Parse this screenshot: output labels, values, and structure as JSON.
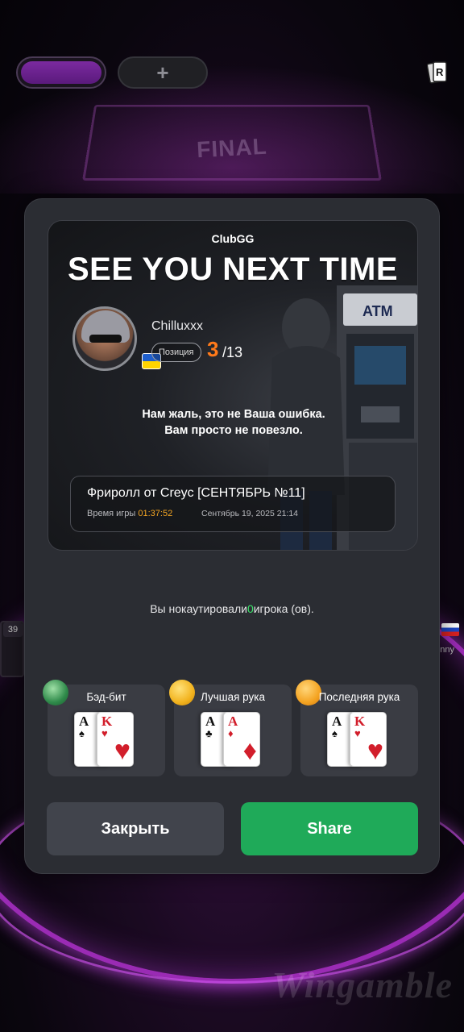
{
  "background": {
    "final_text": "FINAL",
    "left_seat_badge": "39",
    "right_seat_name": "nny",
    "watermark": "Wingamble"
  },
  "topbar": {
    "add_tab_label": "+",
    "corner_icon": "card-icon"
  },
  "card": {
    "brand": "ClubGG",
    "headline": "SEE YOU NEXT TIME",
    "player_name": "Chilluxxx",
    "position_label": "Позиция",
    "position_value": "3",
    "position_total": "/13",
    "flag": "ukraine-flag",
    "sorry_line1": "Нам жаль, это не Ваша ошибка.",
    "sorry_line2": "Вам просто не повезло.",
    "tournament_name": "Фриролл от Creyc [СЕНТЯБРЬ №11]",
    "play_time_label": "Время игры",
    "play_time": "01:37:52",
    "date": "Сентябрь 19, 2025 21:14"
  },
  "knockouts": {
    "prefix": "Вы нокаутировали",
    "count": "0",
    "suffix": "игрока (ов)."
  },
  "hands": [
    {
      "label": "Бэд-бит",
      "card1_rank": "A",
      "card1_suit": "♠",
      "card2_rank": "K",
      "card2_suit": "♥"
    },
    {
      "label": "Лучшая рука",
      "card1_rank": "A",
      "card1_suit": "♣",
      "card2_rank": "A",
      "card2_suit": "♦"
    },
    {
      "label": "Последняя рука",
      "card1_rank": "A",
      "card1_suit": "♠",
      "card2_rank": "K",
      "card2_suit": "♥"
    }
  ],
  "buttons": {
    "close": "Закрыть",
    "share": "Share"
  },
  "colors": {
    "accent_orange": "#ff7a1a",
    "time_color": "#f5a623",
    "share_green": "#1faa59",
    "ko_green": "#3be36a"
  }
}
